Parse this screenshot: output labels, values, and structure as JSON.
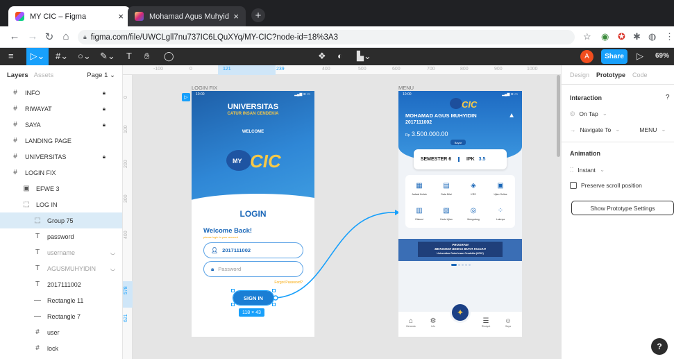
{
  "browser": {
    "tabs": [
      {
        "title": "MY CIC – Figma",
        "close": "×"
      },
      {
        "title": "Mohamad Agus Muhyidin (@mu",
        "close": "×"
      }
    ],
    "new_tab": "+",
    "url": "figma.com/file/UWCLgll7nu737IC6LQuXYq/MY-CIC?node-id=18%3A3"
  },
  "toolbar": {
    "avatar": "A",
    "share_label": "Share",
    "zoom_label": "69%"
  },
  "layers_panel": {
    "tab_layers": "Layers",
    "tab_assets": "Assets",
    "page": "Page 1 ⌄",
    "items": [
      {
        "label": "INFO",
        "icon": "#",
        "locked": true,
        "indent": 0
      },
      {
        "label": "RIWAYAT",
        "icon": "#",
        "locked": true,
        "indent": 0
      },
      {
        "label": "SAYA",
        "icon": "#",
        "locked": true,
        "indent": 0
      },
      {
        "label": "LANDING PAGE",
        "icon": "#",
        "locked": false,
        "indent": 0
      },
      {
        "label": "UNIVERSITAS",
        "icon": "#",
        "locked": true,
        "indent": 0
      },
      {
        "label": "LOGIN FIX",
        "icon": "#",
        "locked": false,
        "indent": 0
      },
      {
        "label": "EFWE 3",
        "icon": "▣",
        "locked": false,
        "indent": 1
      },
      {
        "label": "LOG IN",
        "icon": "⬚",
        "locked": false,
        "indent": 1
      },
      {
        "label": "Group 75",
        "icon": "⬚",
        "locked": false,
        "indent": 2
      },
      {
        "label": "password",
        "icon": "T",
        "locked": false,
        "indent": 2
      },
      {
        "label": "username",
        "icon": "T",
        "locked": false,
        "indent": 2
      },
      {
        "label": "AGUSMUHYIDIN",
        "icon": "T",
        "locked": false,
        "indent": 2
      },
      {
        "label": "2017111002",
        "icon": "T",
        "locked": false,
        "indent": 2
      },
      {
        "label": "Rectangle 11",
        "icon": "—",
        "locked": false,
        "indent": 2
      },
      {
        "label": "Rectangle 7",
        "icon": "—",
        "locked": false,
        "indent": 2
      },
      {
        "label": "user",
        "icon": "#",
        "locked": false,
        "indent": 2
      },
      {
        "label": "lock",
        "icon": "#",
        "locked": false,
        "indent": 2
      }
    ]
  },
  "canvas": {
    "ruler_top": [
      "-100",
      "0",
      "121",
      "239",
      "400",
      "500",
      "600",
      "700",
      "800",
      "900",
      "1000"
    ],
    "ruler_left": [
      "0",
      "100",
      "200",
      "300",
      "400",
      "578",
      "621"
    ],
    "frame_login_label": "LOGIN FIX",
    "frame_menu_label": "MENU",
    "selection_size": "118 × 43"
  },
  "login_screen": {
    "time": "10:00",
    "signal": "▂▄▆ ≋ ▭",
    "university": "UNIVERSITAS",
    "university_sub": "CATUR INSAN CENDEKIA",
    "welcome": "WELCOME",
    "logo_text": "CIC",
    "title": "LOGIN",
    "welcome_back": "Welcome Back!",
    "welcome_sub": "please login to your account",
    "username_value": "2017111002",
    "password_placeholder": "Password",
    "forgot": "Forgot Password?",
    "signin": "SIGN IN"
  },
  "menu_screen": {
    "time": "10:00",
    "signal": "▂▄▆ ≋ ▭",
    "logo_text": "CIC",
    "name": "MOHAMAD AGUS MUHYIDIN",
    "nim": "2017111002",
    "currency": "Rp",
    "balance": "3.500.000.00",
    "pay_label": "Bayar",
    "semester": "SEMESTER 6",
    "ipk_label": "IPK",
    "ipk_value": "3.5",
    "grid": [
      {
        "label": "Jadwal Kuliah",
        "icon": "calendar-icon"
      },
      {
        "label": "Data Nilai",
        "icon": "grades-icon"
      },
      {
        "label": "KRS",
        "icon": "krs-icon"
      },
      {
        "label": "Ujian Online",
        "icon": "exam-online-icon"
      },
      {
        "label": "Diskusi",
        "icon": "discussion-icon"
      },
      {
        "label": "Kartu Ujian",
        "icon": "exam-card-icon"
      },
      {
        "label": "Mengulang",
        "icon": "repeat-icon"
      },
      {
        "label": "Lainnya",
        "icon": "more-icon"
      }
    ],
    "banner_title": "PROGRAM",
    "banner_line2": "BEASISWA BEBAS BIAYA KULIAH",
    "banner_line3": "Universitas Catur Insan Cendekia (UCIC)",
    "bottom_nav": [
      "Beranda",
      "Info",
      "Riwayat",
      "Saya"
    ]
  },
  "right_panel": {
    "tabs": [
      "Design",
      "Prototype",
      "Code"
    ],
    "interaction_title": "Interaction",
    "trigger": "On Tap",
    "action": "Navigate To",
    "destination": "MENU",
    "animation_title": "Animation",
    "animation_type": "Instant",
    "preserve_label": "Preserve scroll position",
    "settings_button": "Show Prototype Settings"
  },
  "help": "?",
  "colors": {
    "figma_blue": "#18a0fb",
    "brand_blue": "#1a67b8",
    "accent_yellow": "#f7c948"
  }
}
